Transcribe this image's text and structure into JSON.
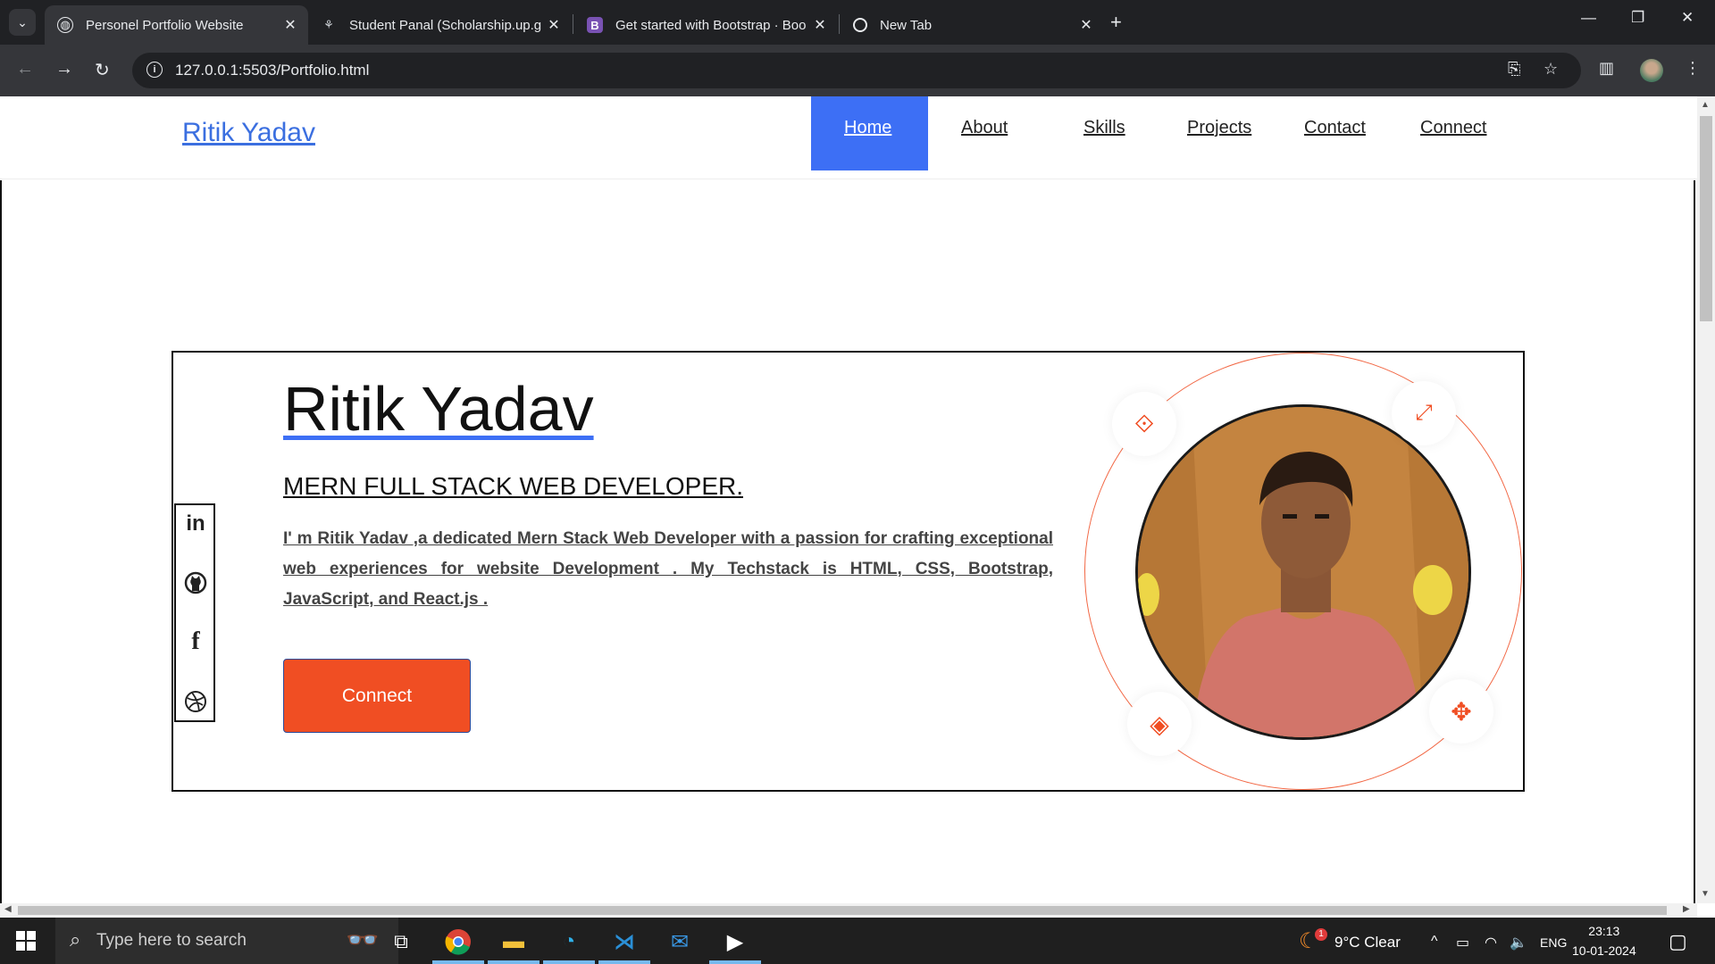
{
  "browser": {
    "tabs": [
      {
        "title": "Personel Portfolio Website",
        "active": true
      },
      {
        "title": "Student Panal (Scholarship.up.g",
        "active": false
      },
      {
        "title": "Get started with Bootstrap · Boo",
        "active": false
      },
      {
        "title": "New Tab",
        "active": false
      }
    ],
    "url": "127.0.0.1:5503/Portfolio.html"
  },
  "site": {
    "brand": "Ritik Yadav",
    "nav": [
      "Home",
      "About",
      "Skills",
      "Projects",
      "Contact",
      "Connect"
    ],
    "active_nav": "Home",
    "hero": {
      "name": "Ritik Yadav",
      "role": "MERN FULL STACK WEB DEVELOPER.",
      "description": "I' m Ritik Yadav ,a dedicated Mern Stack Web Developer with a passion for crafting exceptional web experiences for website Development . My Techstack is HTML, CSS, Bootstrap, JavaScript, and React.js .",
      "button": "Connect"
    },
    "social": [
      "linkedin-icon",
      "github-icon",
      "facebook-icon",
      "dribbble-icon"
    ],
    "accent_color": "#f04e23",
    "link_color": "#3d6ff5"
  },
  "taskbar": {
    "search_placeholder": "Type here to search",
    "weather": "9°C  Clear",
    "language": "ENG",
    "time": "23:13",
    "date": "10-01-2024",
    "weather_badge": "1"
  }
}
